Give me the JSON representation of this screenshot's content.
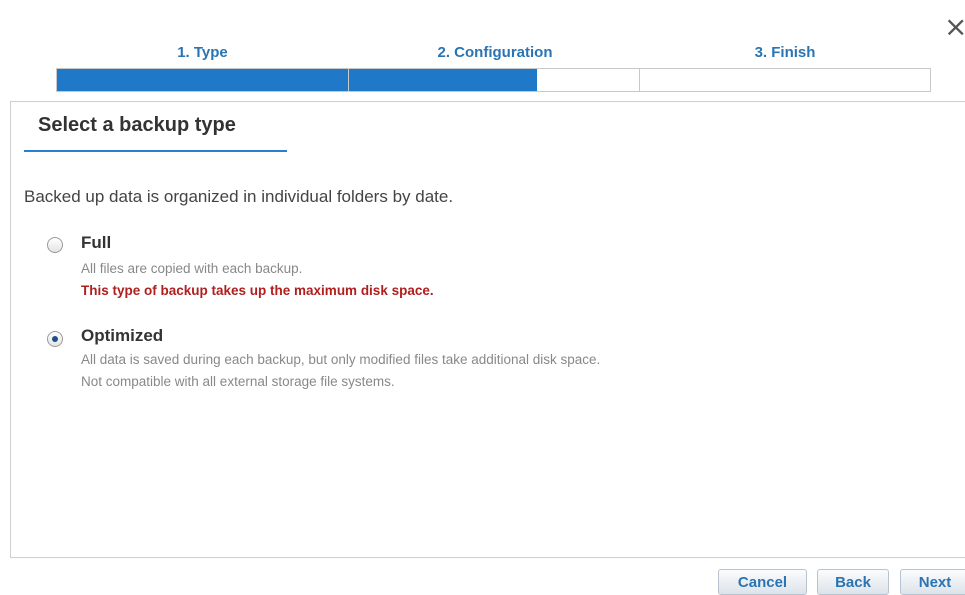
{
  "window": {
    "close_icon": "close-icon"
  },
  "steps": [
    {
      "label": "1. Type",
      "state": "complete"
    },
    {
      "label": "2. Configuration",
      "state": "in-progress"
    },
    {
      "label": "3. Finish",
      "state": "pending"
    }
  ],
  "progress": {
    "fraction_complete": 0.55,
    "fill_color": "#1f78c8"
  },
  "panel": {
    "title": "Select a backup type",
    "intro": "Backed up data is organized in individual folders by date.",
    "options": [
      {
        "label": "Full",
        "selected": false,
        "description": [
          "All files are copied with each backup."
        ],
        "warning": "This type of backup takes up the maximum disk space."
      },
      {
        "label": "Optimized",
        "selected": true,
        "description": [
          "All data is saved during each backup, but only modified files take additional disk space.",
          "Not compatible with all external storage file systems."
        ]
      }
    ]
  },
  "buttons": {
    "cancel": "Cancel",
    "back": "Back",
    "next": "Next"
  },
  "colors": {
    "accent": "#2a74b4",
    "warning": "#b01e1e"
  }
}
